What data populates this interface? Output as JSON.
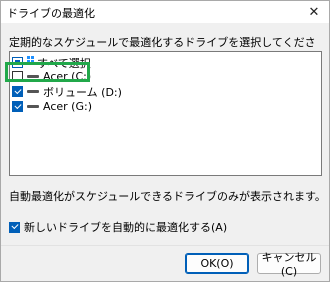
{
  "window": {
    "title": "ドライブの最適化",
    "close_glyph": "✕"
  },
  "prompt": "定期的なスケジュールで最適化するドライブを選択してください:",
  "drives": [
    {
      "label": "すべて選択",
      "state": "indeterminate",
      "icon": "windows-logo-icon"
    },
    {
      "label": "Acer (C:)",
      "state": "unchecked",
      "icon": "drive-icon"
    },
    {
      "label": "ボリューム (D:)",
      "state": "checked",
      "icon": "drive-icon"
    },
    {
      "label": "Acer (G:)",
      "state": "checked",
      "icon": "drive-icon"
    }
  ],
  "note": "自動最適化がスケジュールできるドライブのみが表示されます。",
  "auto_option": {
    "label": "新しいドライブを自動的に最適化する(A)",
    "checked": true
  },
  "buttons": {
    "ok": "OK(O)",
    "cancel": "キャンセル(C)"
  },
  "colors": {
    "accent": "#005fb8",
    "highlight": "#21a84a"
  }
}
